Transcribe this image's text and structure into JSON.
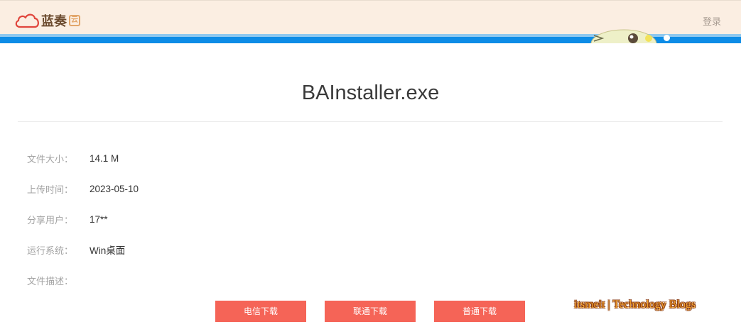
{
  "header": {
    "logo_text": "蓝奏",
    "logo_badge": "云",
    "login_label": "登录"
  },
  "file": {
    "name": "BAInstaller.exe",
    "info": [
      {
        "label": "文件大小：",
        "value": "14.1 M"
      },
      {
        "label": "上传时间：",
        "value": "2023-05-10"
      },
      {
        "label": "分享用户：",
        "value": "17**"
      },
      {
        "label": "运行系统：",
        "value": "Win桌面"
      },
      {
        "label": "文件描述：",
        "value": ""
      }
    ]
  },
  "buttons": {
    "telecom": "电信下载",
    "unicom": "联通下载",
    "normal": "普通下载"
  },
  "watermark": "itsmeit | Technology Blogs",
  "colors": {
    "header_bg": "#fbeee2",
    "banner_blue": "#0d8ce6",
    "button": "#f56457"
  },
  "icons": [
    "cloud-logo-icon",
    "mascot-icon"
  ]
}
